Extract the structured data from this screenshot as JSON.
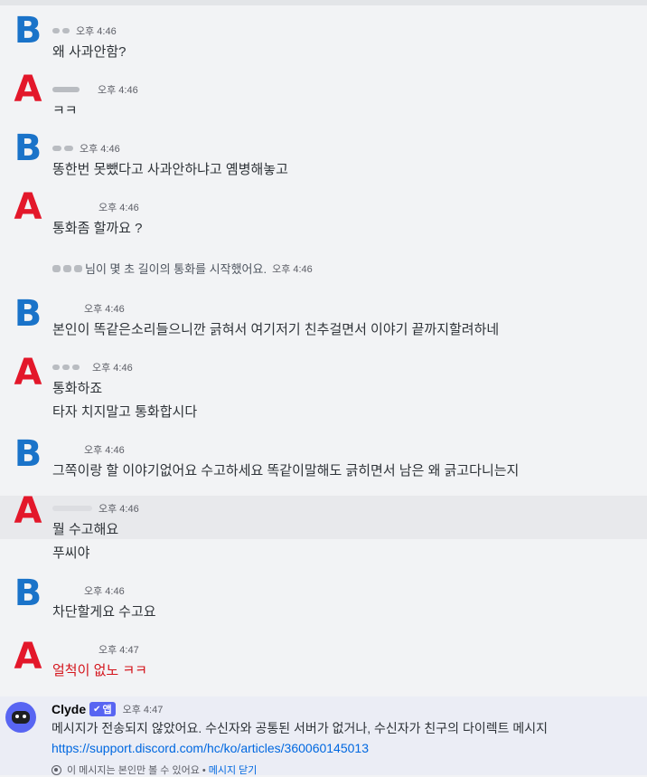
{
  "messages": [
    {
      "avatar": "B",
      "time": "오후 4:46",
      "lines": [
        "왜 사과안함?"
      ]
    },
    {
      "avatar": "A",
      "time": "오후 4:46",
      "lines": [
        "ㅋㅋ"
      ]
    },
    {
      "avatar": "B",
      "time": "오후 4:46",
      "lines": [
        "똥한번 못뺐다고 사과안하냐고 옘병해놓고"
      ]
    },
    {
      "avatar": "A",
      "time": "오후 4:46",
      "lines": [
        "통화좀 할까요 ?"
      ]
    },
    {
      "avatar": "B",
      "time": "오후 4:46",
      "lines": [
        "본인이 똑같은소리들으니깐 긁혀서 여기저기 친추걸면서 이야기 끝까지할려하네"
      ]
    },
    {
      "avatar": "A",
      "time": "오후 4:46",
      "lines": [
        "통화하죠",
        "타자 치지말고 통화합시다"
      ]
    },
    {
      "avatar": "B",
      "time": "오후 4:46",
      "lines": [
        "그쪽이랑 할 이야기없어요 수고하세요 똑같이말해도 긁히면서 남은 왜 긁고다니는지"
      ]
    },
    {
      "avatar": "A",
      "time": "오후 4:46",
      "lines": [
        "뭘 수고해요",
        "푸씨야"
      ]
    },
    {
      "avatar": "B",
      "time": "오후 4:46",
      "lines": [
        "차단할게요 수고요"
      ]
    },
    {
      "avatar": "A",
      "time": "오후 4:47",
      "lines": [
        "얼척이 없노 ㅋㅋ"
      ]
    }
  ],
  "system_message": {
    "text": "님이 몇 초 길이의 통화를 시작했어요.",
    "time": "오후 4:46"
  },
  "clyde": {
    "name": "Clyde",
    "badge": "앱",
    "time": "오후 4:47",
    "text": "메시지가 전송되지 않았어요. 수신자와 공통된 서버가 없거나, 수신자가 친구의 다이렉트 메시지",
    "link": "https://support.discord.com/hc/ko/articles/360060145013",
    "ephemeral_note": "이 메시지는 본인만 볼 수 있어요 •",
    "dismiss_label": "메시지 닫기"
  },
  "colors": {
    "avatar_b": "#1a73c9",
    "avatar_a": "#e3172a",
    "link": "#0068e0",
    "badge": "#5865f2"
  }
}
